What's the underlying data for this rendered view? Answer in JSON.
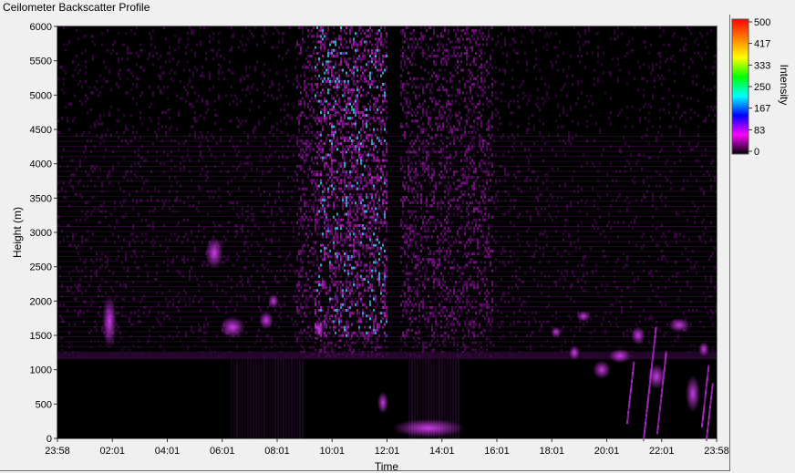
{
  "window": {
    "title": "Ceilometer Backscatter Profile"
  },
  "colors": {
    "plot_background": "#000000",
    "page_background": "#f0f0f0",
    "signal_primary": "#c024d8",
    "signal_peak": "#30c8ff"
  },
  "chart_data": {
    "type": "heatmap",
    "title": "",
    "xlabel": "Time",
    "ylabel": "Height (m)",
    "x_ticks": [
      "23:58",
      "02:01",
      "04:01",
      "06:01",
      "08:01",
      "10:01",
      "12:01",
      "14:01",
      "16:01",
      "18:01",
      "20:01",
      "22:01",
      "23:58"
    ],
    "y_ticks": [
      0,
      500,
      1000,
      1500,
      2000,
      2500,
      3000,
      3500,
      4000,
      4500,
      5000,
      5500,
      6000
    ],
    "ylim": [
      0,
      6000
    ],
    "colorbar": {
      "label": "Intensity",
      "ticks": [
        0,
        83,
        167,
        250,
        333,
        417,
        500
      ],
      "range": [
        0,
        500
      ],
      "stops": [
        "#000000",
        "#ff00ff",
        "#0000ff",
        "#00ffff",
        "#00ff00",
        "#ffff00",
        "#ff8000",
        "#ff0000"
      ]
    },
    "grid": false
  }
}
